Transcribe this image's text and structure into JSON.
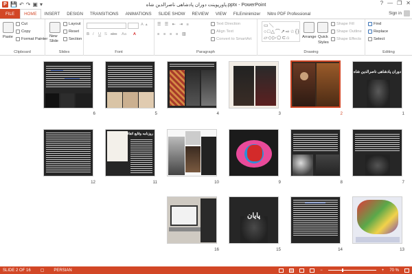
{
  "titlebar": {
    "title": "پاورپوینت دوران پادشاهی ناصرالدین شاه.pptx - PowerPoint",
    "app_letter": "P",
    "qat_save": "💾",
    "qat_undo": "↶",
    "qat_redo": "↷",
    "qat_present": "▣",
    "qat_more": "▾",
    "help": "?",
    "minimize": "—",
    "restore": "❐",
    "close": "✕"
  },
  "tabs": [
    "FILE",
    "HOME",
    "INSERT",
    "DESIGN",
    "TRANSITIONS",
    "ANIMATIONS",
    "SLIDE SHOW",
    "REVIEW",
    "VIEW",
    "FILEminimizer",
    "Nitro PDF Professional"
  ],
  "active_tab": "HOME",
  "signin": "Sign in",
  "ribbon": {
    "clipboard": {
      "label": "Clipboard",
      "paste": "Paste",
      "cut": "Cut",
      "copy": "Copy",
      "format_painter": "Format Painter"
    },
    "slides": {
      "label": "Slides",
      "new_slide": "New",
      "new_slide_2": "Slide",
      "layout": "Layout",
      "reset": "Reset",
      "section": "Section"
    },
    "font": {
      "label": "Font",
      "bold": "B",
      "italic": "I",
      "underline": "U",
      "strike": "S",
      "abc": "abc",
      "aa": "Aa"
    },
    "paragraph": {
      "label": "Paragraph",
      "text_direction": "Text Direction",
      "align_text": "Align Text",
      "smartart": "Convert to SmartArt"
    },
    "drawing": {
      "label": "Drawing",
      "arrange": "Arrange",
      "quick_styles": "Quick",
      "quick_styles_2": "Styles",
      "shape_fill": "Shape Fill",
      "shape_outline": "Shape Outline",
      "shape_effects": "Shape Effects",
      "shapes_glyphs": "▭＼○□△⌒↗⇨☆{}▱◇▷⬠⊂⌂"
    },
    "editing": {
      "label": "Editing",
      "find": "Find",
      "replace": "Replace",
      "select": "Select"
    }
  },
  "slides": [
    {
      "num": "1",
      "title": "دوران پادشاهی ناصرالدین شاه"
    },
    {
      "num": "2"
    },
    {
      "num": "3"
    },
    {
      "num": "4"
    },
    {
      "num": "5"
    },
    {
      "num": "6"
    },
    {
      "num": "7"
    },
    {
      "num": "8"
    },
    {
      "num": "9"
    },
    {
      "num": "10"
    },
    {
      "num": "11",
      "title": "روزنامه وقایع اتفاقیه"
    },
    {
      "num": "12"
    },
    {
      "num": "13"
    },
    {
      "num": "14"
    },
    {
      "num": "15",
      "title": "پایان"
    },
    {
      "num": "16"
    }
  ],
  "selected_slide": "2",
  "statusbar": {
    "slide_info": "SLIDE 2 OF 16",
    "language": "PERSIAN",
    "zoom": "70 %",
    "zoom_minus": "−",
    "zoom_plus": "+"
  },
  "colors": {
    "accent": "#d24726"
  }
}
